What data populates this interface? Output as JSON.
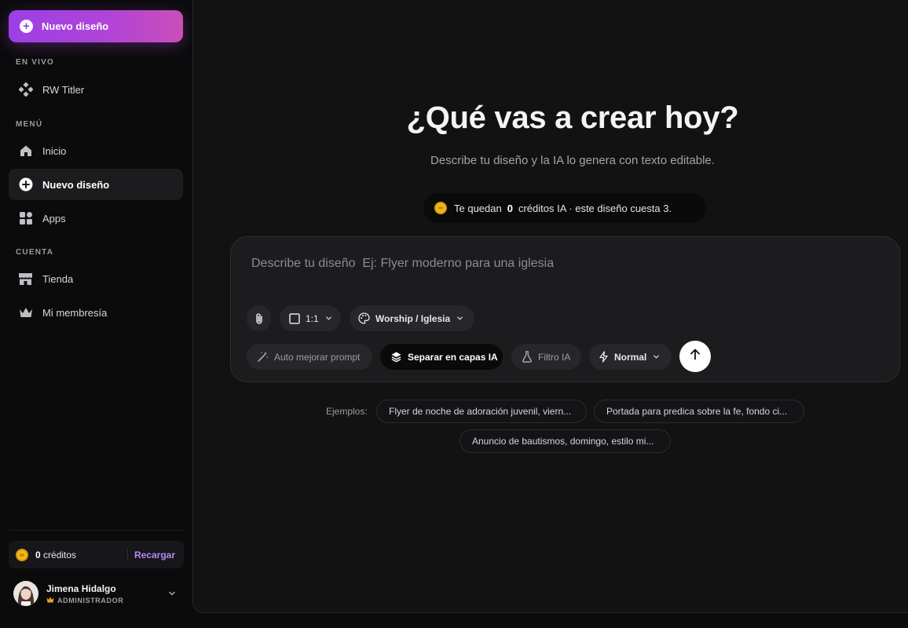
{
  "sidebar": {
    "new_design_label": "Nuevo diseño",
    "sections": {
      "live": "EN VIVO",
      "menu": "MENÚ",
      "account": "CUENTA"
    },
    "items": {
      "rw_titler": "RW Titler",
      "inicio": "Inicio",
      "nuevo_diseno": "Nuevo diseño",
      "apps": "Apps",
      "tienda": "Tienda",
      "membresia": "Mi membresía"
    },
    "credits": {
      "amount": "0",
      "label": "créditos",
      "recharge": "Recargar"
    },
    "user": {
      "name": "Jimena Hidalgo",
      "role": "ADMINISTRADOR"
    }
  },
  "main": {
    "headline": "¿Qué vas a crear hoy?",
    "subline": "Describe tu diseño y la IA lo genera con texto editable.",
    "credits_notice": {
      "prefix": "Te quedan",
      "amount": "0",
      "suffix": "créditos IA · este diseño cuesta 3."
    },
    "prompt": {
      "placeholder": "Describe tu diseño  Ej: Flyer moderno para una iglesia",
      "value": ""
    },
    "controls": {
      "aspect_ratio": "1:1",
      "style": "Worship / Iglesia",
      "auto_improve": "Auto mejorar prompt",
      "layers": "Separar en capas IA",
      "filter": "Filtro IA",
      "mode": "Normal"
    },
    "examples": {
      "label": "Ejemplos:",
      "items": [
        "Flyer de noche de adoración juvenil, viern...",
        "Portada para predica sobre la fe, fondo ci...",
        "Anuncio de bautismos, domingo, estilo mi..."
      ]
    }
  },
  "colors": {
    "accent_gradient_start": "#9b3fe6",
    "accent_gradient_end": "#c94fb8",
    "recharge_link": "#b88af0",
    "coin": "#f1b71c",
    "background": "#0b0b0c",
    "panel": "#121213"
  }
}
